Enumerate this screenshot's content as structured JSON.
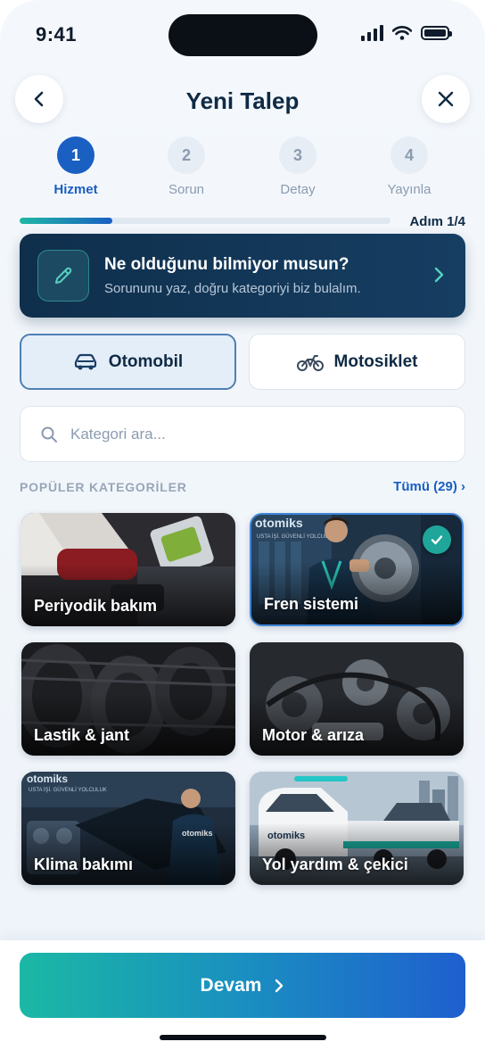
{
  "status_bar": {
    "time": "9:41"
  },
  "header": {
    "title": "Yeni Talep"
  },
  "stepper": {
    "steps": [
      {
        "number": "1",
        "label": "Hizmet",
        "active": true
      },
      {
        "number": "2",
        "label": "Sorun",
        "active": false
      },
      {
        "number": "3",
        "label": "Detay",
        "active": false
      },
      {
        "number": "4",
        "label": "Yayınla",
        "active": false
      }
    ],
    "progress_text": "Adım 1/4",
    "progress_fraction": 0.25
  },
  "hint_card": {
    "title": "Ne olduğunu bilmiyor musun?",
    "subtitle": "Sorununu yaz, doğru kategoriyi biz bulalım."
  },
  "vehicle_types": [
    {
      "label": "Otomobil",
      "icon": "car-icon",
      "selected": true
    },
    {
      "label": "Motosiklet",
      "icon": "motorcycle-icon",
      "selected": false
    }
  ],
  "search": {
    "placeholder": "Kategori ara..."
  },
  "categories_section": {
    "title": "POPÜLER KATEGORİLER",
    "see_all": "Tümü (29) ›"
  },
  "categories": [
    {
      "label": "Periyodik bakım",
      "selected": false
    },
    {
      "label": "Fren sistemi",
      "selected": true
    },
    {
      "label": "Lastik & jant",
      "selected": false
    },
    {
      "label": "Motor & arıza",
      "selected": false
    },
    {
      "label": "Klima bakımı",
      "selected": false
    },
    {
      "label": "Yol yardım & çekici",
      "selected": false
    }
  ],
  "footer": {
    "continue_label": "Devam"
  },
  "colors": {
    "accent_blue": "#1a5fc2",
    "accent_teal": "#1fb8a6",
    "navy": "#0f2f4c"
  }
}
